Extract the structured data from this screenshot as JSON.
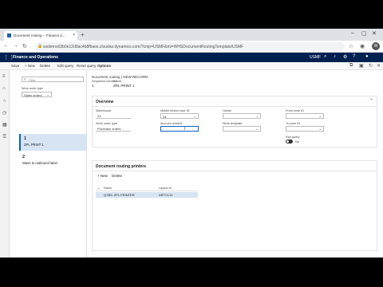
{
  "browser": {
    "tab_title": "Document routing -- Finance a...",
    "url": "wsdemo03b0e12d9ac4b8fbaos.cloudax.dynamics.com/?cmp=USMF&mi=WHSDocumentRoutingTemplate/USMF",
    "profile_initial": "W"
  },
  "app": {
    "title": "Finance and Operations",
    "company": "USMF"
  },
  "actions": {
    "save": "Save",
    "new": "+ New",
    "delete": "Delete",
    "edit_query": "Edit query",
    "reset_query": "Reset query",
    "options": "Options"
  },
  "list": {
    "filter_placeholder": "Filter",
    "process_label": "Work order type",
    "process_value": "Sales orders",
    "rows": [
      {
        "seq": "1",
        "name": "ZPL PRINT 1"
      },
      {
        "seq": "2",
        "name": "Wave to outbound label"
      }
    ]
  },
  "record": {
    "breadcrumb": "Document routing  |  NEW RECORD",
    "seq_label": "Sequence number",
    "seq_value": "1",
    "name_label": "Name",
    "name_value": "ZPL PRINT 1"
  },
  "overview": {
    "title": "Overview",
    "warehouse_label": "Warehouse",
    "warehouse_value": "24",
    "mobile_user_label": "Mobile device user ID",
    "mobile_user_value": "24",
    "owner_label": "Owner",
    "owner_value": "",
    "from_zone_label": "From zone ID",
    "from_zone_value": "",
    "work_order_type_label": "Work order type",
    "work_order_type_value": "Purchase orders",
    "account_label": "Account number",
    "account_value": "",
    "work_template_label": "Work template",
    "work_template_value": "",
    "to_zone_label": "To zone ID",
    "to_zone_value": "",
    "run_query_label": "Run query",
    "run_query_value": "No"
  },
  "printers": {
    "title": "Document routing printers",
    "new": "+ New",
    "delete": "Delete",
    "col_name": "Name",
    "col_layout": "Layout ID",
    "row_name": "Q BEL ZPL PRINTER",
    "row_layout": "ARTCL11"
  }
}
